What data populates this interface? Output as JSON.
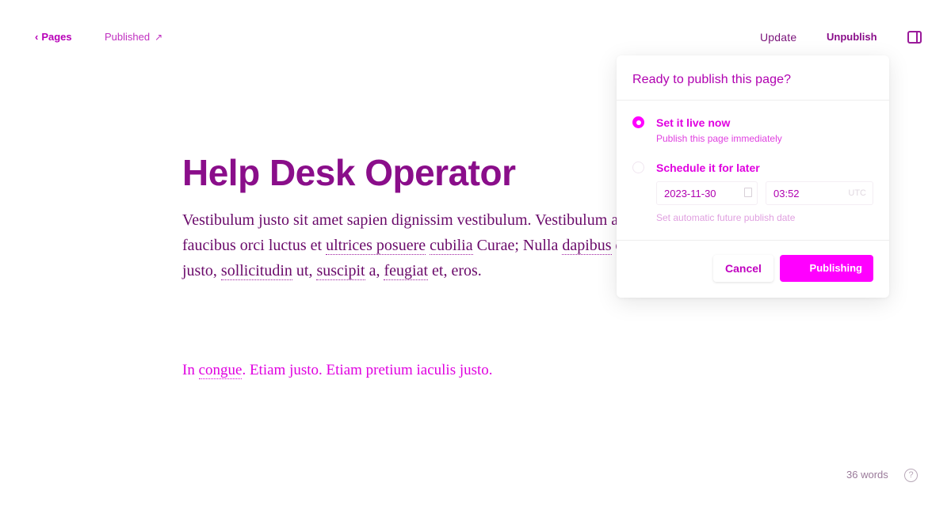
{
  "header": {
    "back_label": "Pages",
    "status_label": "Published",
    "update_label": "Update",
    "unpublish_label": "Unpublish"
  },
  "post": {
    "title": "Help Desk Operator",
    "body_pre1": "Vestibulum justo sit amet sapien dignissim vestibulum. Vestibulum ante ipsum primis in faucibus orci luctus et ",
    "body_u1": "ultrices posuere",
    "body_mid1": " ",
    "body_u2": "cubilia",
    "body_mid2": " Curae; Nulla ",
    "body_u3": "dapibus",
    "body_mid3": " dolor vel est. Donec odio justo, ",
    "body_u4": "sollicitudin",
    "body_mid4": " ut, ",
    "body_u5": "suscipit",
    "body_mid5": " a, ",
    "body_u6": "feugiat",
    "body_end": " et, eros.",
    "para2_pre": "In ",
    "para2_u": "congue",
    "para2_end": ". Etiam justo. Etiam pretium iaculis justo."
  },
  "footer": {
    "word_count": "36 words",
    "help_glyph": "?"
  },
  "publish_popover": {
    "title": "Ready to publish this page?",
    "option_now_label": "Set it live now",
    "option_now_desc": "Publish this page immediately",
    "option_later_label": "Schedule it for later",
    "date_value": "2023-11-30",
    "time_value": "03:52",
    "timezone": "UTC",
    "hint": "Set automatic future publish date",
    "cancel_label": "Cancel",
    "publish_label": "Publishing",
    "selected_option": "now"
  },
  "colors": {
    "accent": "#ff00ff",
    "title": "#8a0e8a"
  },
  "icons": {
    "back": "chevron-left-icon",
    "status": "arrow-up-right-icon",
    "sidebar": "sidebar-toggle-icon",
    "help": "help-icon",
    "calendar": "calendar-icon"
  }
}
